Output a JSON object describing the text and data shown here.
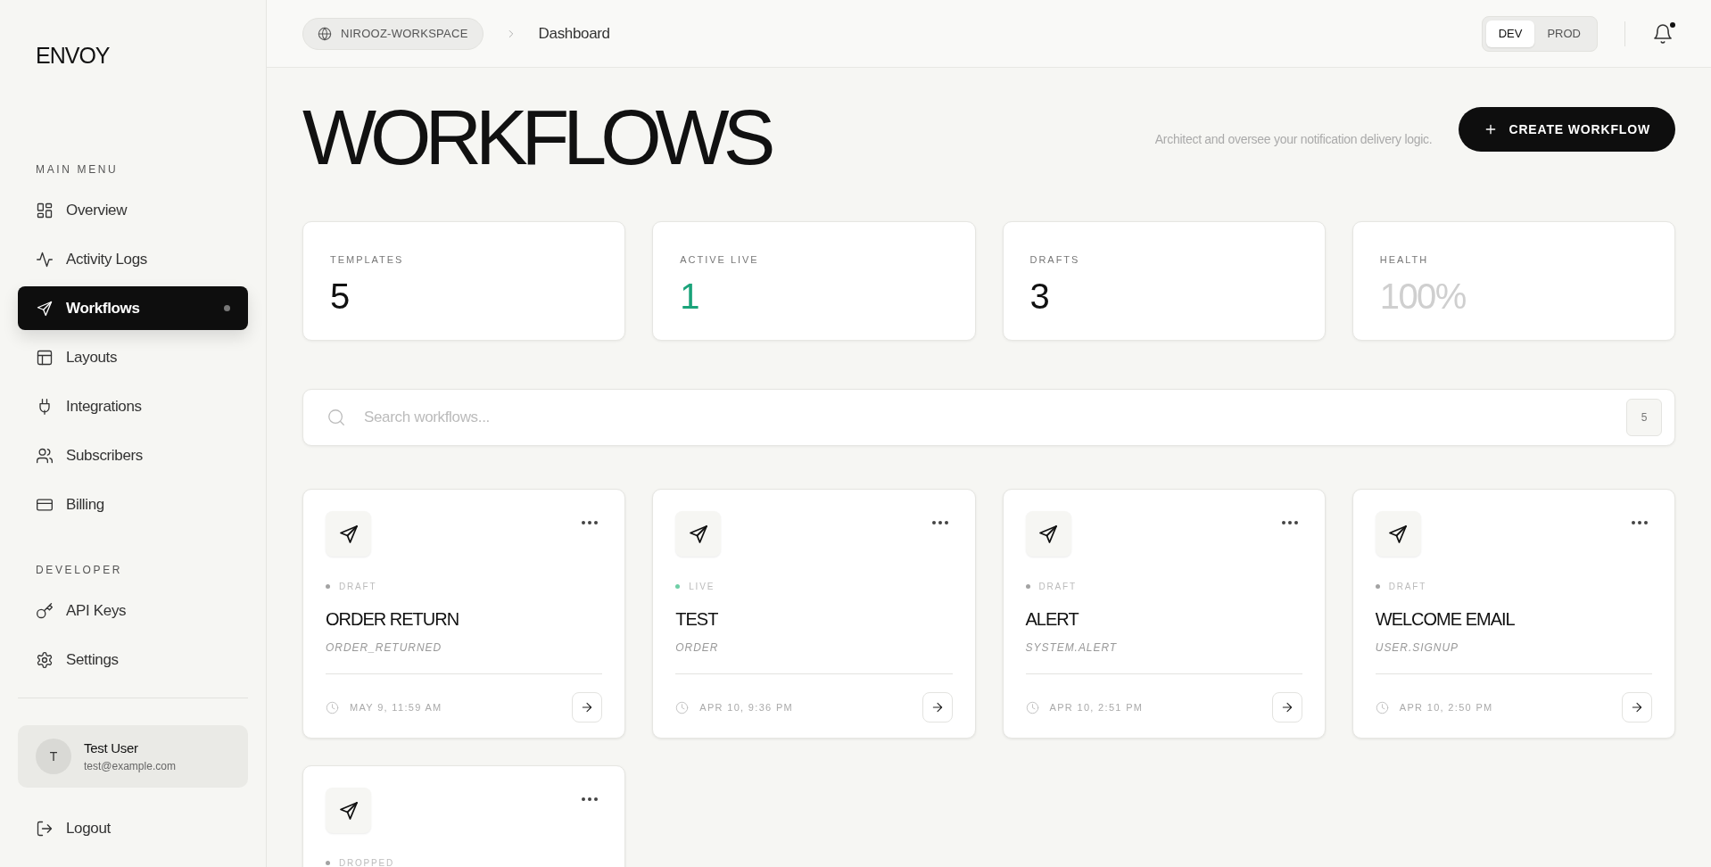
{
  "sidebar": {
    "logo": "ENVOY",
    "sections": [
      {
        "title": "MAIN MENU",
        "items": [
          {
            "label": "Overview",
            "selected": false
          },
          {
            "label": "Activity Logs",
            "selected": false
          },
          {
            "label": "Workflows",
            "selected": true
          },
          {
            "label": "Layouts",
            "selected": false
          },
          {
            "label": "Integrations",
            "selected": false
          },
          {
            "label": "Subscribers",
            "selected": false
          },
          {
            "label": "Billing",
            "selected": false
          }
        ]
      },
      {
        "title": "DEVELOPER",
        "items": [
          {
            "label": "API Keys",
            "selected": false
          },
          {
            "label": "Settings",
            "selected": false
          }
        ]
      }
    ],
    "user": {
      "initial": "T",
      "name": "Test User",
      "email": "test@example.com"
    },
    "logout": "Logout"
  },
  "header": {
    "workspace": "NIROOZ-WORKSPACE",
    "page": "Dashboard",
    "environments": [
      {
        "label": "DEV",
        "selected": true
      },
      {
        "label": "PROD",
        "selected": false
      }
    ],
    "notifications": {
      "unread": true
    }
  },
  "title": "WORKFLOWS",
  "subtitle": "Architect and oversee your notification delivery logic.",
  "create_button": "CREATE WORKFLOW",
  "stats": [
    {
      "label": "TEMPLATES",
      "value": "5",
      "color": "#111111"
    },
    {
      "label": "ACTIVE LIVE",
      "value": "1",
      "color": "#1aa37a"
    },
    {
      "label": "DRAFTS",
      "value": "3",
      "color": "#111111"
    },
    {
      "label": "HEALTH",
      "value": "100%",
      "color": "#cfcfcf"
    }
  ],
  "search": {
    "placeholder": "Search workflows...",
    "count": "5"
  },
  "workflows": [
    {
      "status": "DRAFT",
      "color": "#a3a3a3",
      "name": "ORDER RETURN",
      "trigger": "ORDER_RETURNED",
      "updated": "MAY 9, 11:59 AM"
    },
    {
      "status": "LIVE",
      "color": "#6fcfa6",
      "name": "TEST",
      "trigger": "ORDER",
      "updated": "APR 10, 9:36 PM"
    },
    {
      "status": "DRAFT",
      "color": "#a3a3a3",
      "name": "ALERT",
      "trigger": "SYSTEM.ALERT",
      "updated": "APR 10, 2:51 PM"
    },
    {
      "status": "DRAFT",
      "color": "#a3a3a3",
      "name": "WELCOME EMAIL",
      "trigger": "USER.SIGNUP",
      "updated": "APR 10, 2:50 PM"
    },
    {
      "status": "DROPPED",
      "color": "#a3a3a3"
    }
  ]
}
